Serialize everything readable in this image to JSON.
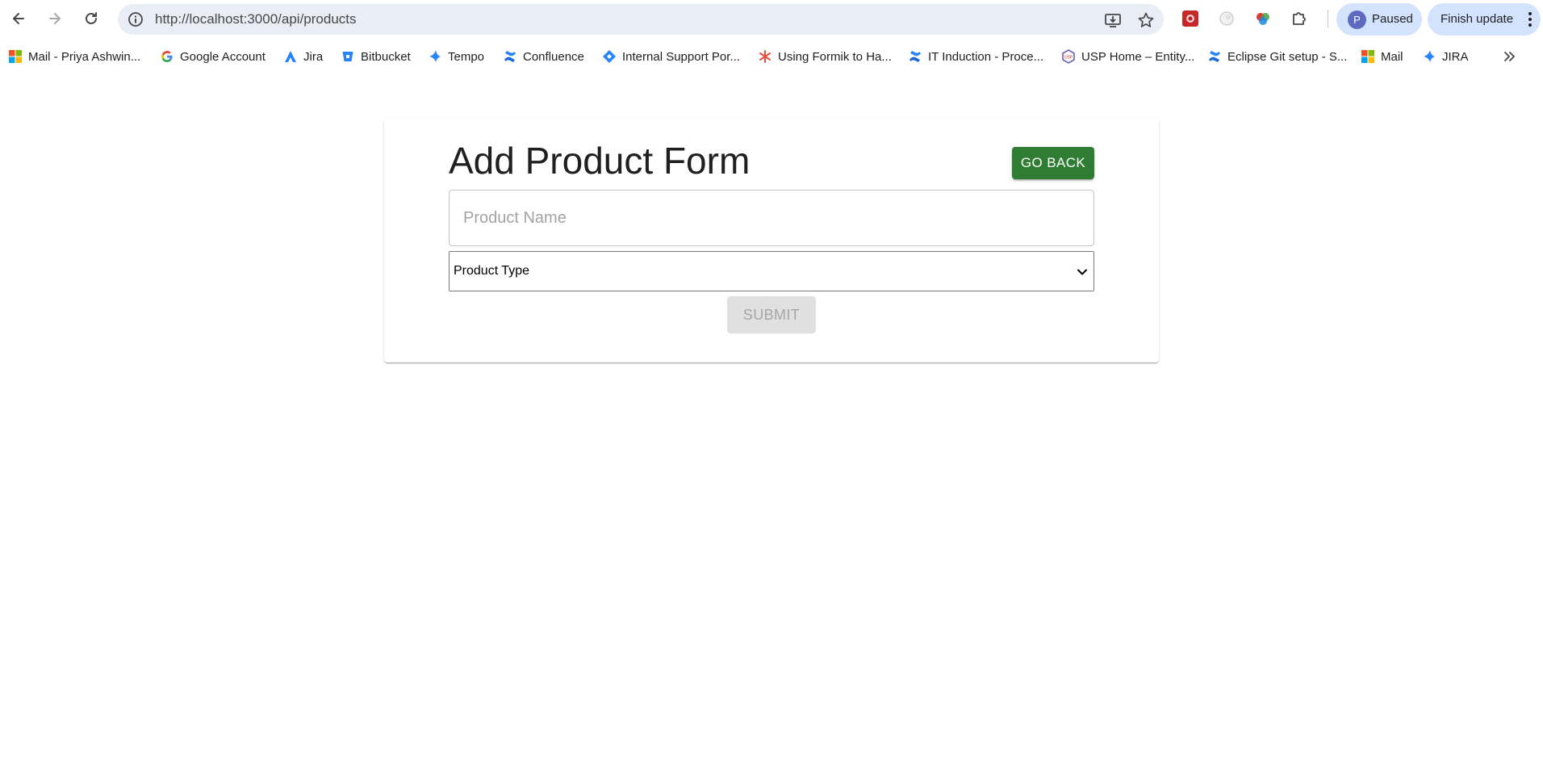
{
  "browser": {
    "url": "http://localhost:3000/api/products",
    "profile_initial": "P",
    "profile_status": "Paused",
    "update_label": "Finish update"
  },
  "bookmarks": [
    {
      "label": "Mail - Priya Ashwin...",
      "icon": "microsoft-icon"
    },
    {
      "label": "Google Account",
      "icon": "google-icon"
    },
    {
      "label": "Jira",
      "icon": "jira-icon"
    },
    {
      "label": "Bitbucket",
      "icon": "bitbucket-icon"
    },
    {
      "label": "Tempo",
      "icon": "tempo-icon"
    },
    {
      "label": "Confluence",
      "icon": "confluence-icon"
    },
    {
      "label": "Internal Support Por...",
      "icon": "jira-service-icon"
    },
    {
      "label": "Using Formik to Ha...",
      "icon": "asterisk-icon"
    },
    {
      "label": "IT Induction - Proce...",
      "icon": "confluence-icon"
    },
    {
      "label": "USP Home – Entity...",
      "icon": "usp-icon"
    },
    {
      "label": "Eclipse Git setup - S...",
      "icon": "confluence-icon"
    },
    {
      "label": "Mail",
      "icon": "microsoft-icon"
    },
    {
      "label": "JIRA",
      "icon": "tempo-icon"
    }
  ],
  "form": {
    "title": "Add Product Form",
    "go_back_label": "GO BACK",
    "product_name_placeholder": "Product Name",
    "product_type_value": "Product Type",
    "submit_label": "SUBMIT"
  },
  "colors": {
    "go_back_bg": "#2e7d32",
    "submit_disabled_bg": "#e0e0e0",
    "omnibox_bg": "#e9eef6",
    "profile_chip_bg": "#d3e3fd"
  }
}
